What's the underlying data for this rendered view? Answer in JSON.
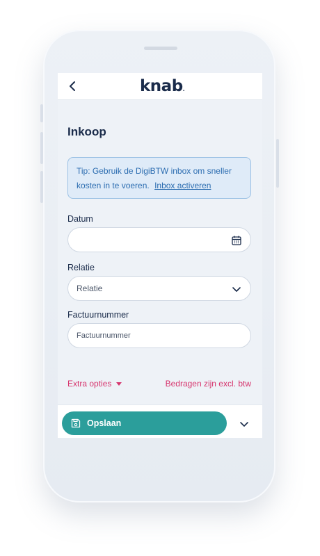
{
  "header": {
    "logo_text": "knab"
  },
  "page": {
    "title": "Inkoop"
  },
  "tip": {
    "text": "Tip: Gebruik de DigiBTW inbox om sneller kosten in te voeren.",
    "link_label": "Inbox activeren"
  },
  "form": {
    "date": {
      "label": "Datum",
      "value": ""
    },
    "relation": {
      "label": "Relatie",
      "selected": "Relatie"
    },
    "invoice": {
      "label": "Factuurnummer",
      "placeholder": "Factuurnummer"
    }
  },
  "options": {
    "extra_label": "Extra opties",
    "amounts_label": "Bedragen zijn excl. btw"
  },
  "footer": {
    "save_label": "Opslaan"
  },
  "colors": {
    "accent": "#2b9e9b",
    "link_pink": "#d6336c",
    "tip_text": "#2b6cb0",
    "title": "#1a2b4a"
  }
}
